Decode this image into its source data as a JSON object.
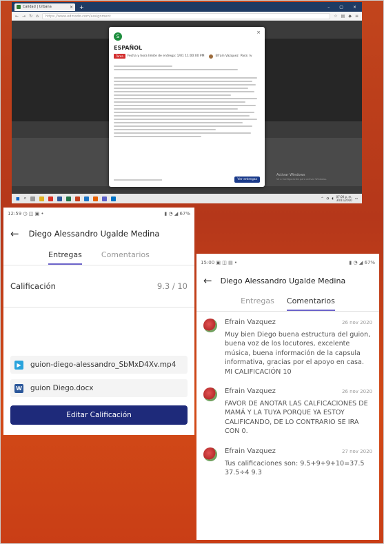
{
  "desktop": {
    "browser_tab_title": "Calidad | Urbana",
    "url": "https://www.edmodo.com/assignment",
    "modal": {
      "logo_letter": "S",
      "title": "ESPAÑOL",
      "badge": "Tarea",
      "meta_text": "Fecha y hora límite de entrega: 1/01 11:00:00 PM",
      "teacher_name": "Efraín Vazquez",
      "meta_suffix": "Para: Iv",
      "submit_label": "Ver entregas",
      "footer_text": "Asignado el 26 de noviembre de 2020"
    },
    "watermark_title": "Activar Windows",
    "watermark_sub": "Ve a Configuración para activar Windows.",
    "clock_time": "07:00 p. m.",
    "clock_date": "30/11/2020"
  },
  "phone1": {
    "status_time": "12:59",
    "status_right": "67%",
    "title": "Diego Alessandro Ugalde Medina",
    "tabs": [
      "Entregas",
      "Comentarios"
    ],
    "grade_label": "Calificación",
    "grade_value": "9.3 / 10",
    "files": [
      {
        "name": "guion-diego-alessandro_SbMxD4Xv.mp4",
        "type": "video"
      },
      {
        "name": "guion Diego.docx",
        "type": "doc"
      }
    ],
    "edit_button": "Editar Calificación"
  },
  "phone2": {
    "status_time": "15:00",
    "status_right": "67%",
    "title": "Diego Alessandro Ugalde Medina",
    "tabs": [
      "Entregas",
      "Comentarios"
    ],
    "comments": [
      {
        "author": "Efrain Vazquez",
        "date": "26 nov 2020",
        "text": "Muy bien Diego buena estructura del guion, buena voz de los locutores, excelente música, buena información de la capsula informativa, gracias por el apoyo en casa. MI CALIFICACIÓN 10"
      },
      {
        "author": "Efrain Vazquez",
        "date": "26 nov 2020",
        "text": "FAVOR DE ANOTAR LAS CALFICACIONES DE MAMÁ Y LA TUYA PORQUE YA ESTOY CALIFICANDO, DE LO CONTRARIO SE IRA CON 0."
      },
      {
        "author": "Efrain Vazquez",
        "date": "27 nov 2020",
        "text": "Tus calificaciones son: 9.5+9+9+10=37.5 37.5÷4 9.3"
      }
    ]
  }
}
